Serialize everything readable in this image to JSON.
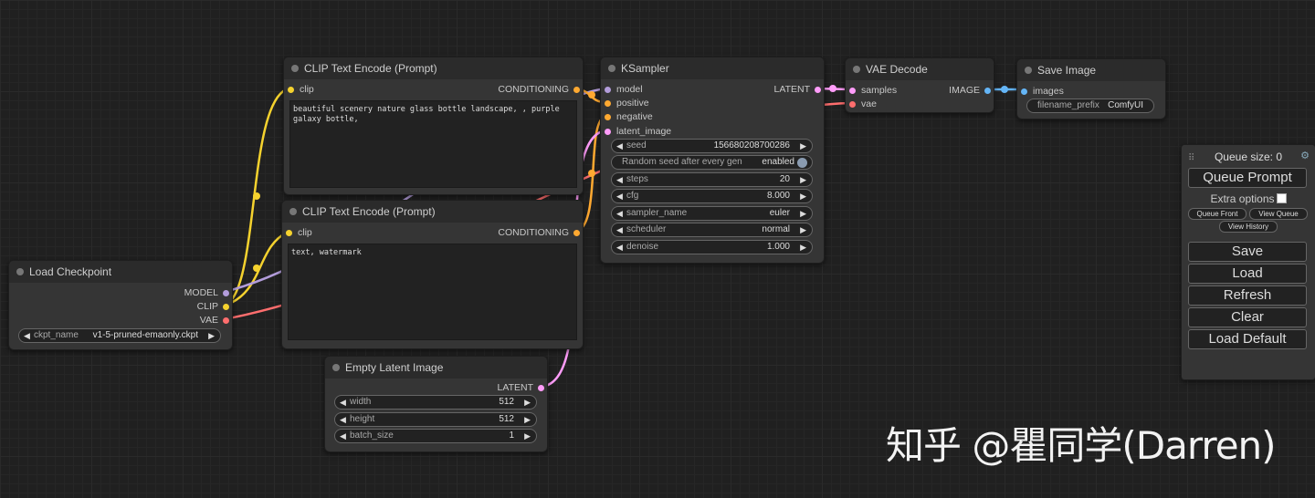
{
  "nodes": {
    "clip_pos": {
      "title": "CLIP Text Encode (Prompt)",
      "input": "clip",
      "output": "CONDITIONING",
      "text": "beautiful scenery nature glass bottle landscape, , purple galaxy bottle,"
    },
    "clip_neg": {
      "title": "CLIP Text Encode (Prompt)",
      "input": "clip",
      "output": "CONDITIONING",
      "text": "text, watermark"
    },
    "load_checkpoint": {
      "title": "Load Checkpoint",
      "outputs": [
        "MODEL",
        "CLIP",
        "VAE"
      ],
      "widget": {
        "label": "ckpt_name",
        "value": "v1-5-pruned-emaonly.ckpt"
      }
    },
    "ksampler": {
      "title": "KSampler",
      "inputs": [
        "model",
        "positive",
        "negative",
        "latent_image"
      ],
      "output": "LATENT",
      "widgets": [
        {
          "label": "seed",
          "value": "156680208700286"
        },
        {
          "label": "Random seed after every gen",
          "value": "enabled"
        },
        {
          "label": "steps",
          "value": "20"
        },
        {
          "label": "cfg",
          "value": "8.000"
        },
        {
          "label": "sampler_name",
          "value": "euler"
        },
        {
          "label": "scheduler",
          "value": "normal"
        },
        {
          "label": "denoise",
          "value": "1.000"
        }
      ]
    },
    "vae_decode": {
      "title": "VAE Decode",
      "inputs": [
        "samples",
        "vae"
      ],
      "output": "IMAGE"
    },
    "save_image": {
      "title": "Save Image",
      "input": "images",
      "widget": {
        "label": "filename_prefix",
        "value": "ComfyUI"
      }
    },
    "empty_latent": {
      "title": "Empty Latent Image",
      "output": "LATENT",
      "widgets": [
        {
          "label": "width",
          "value": "512"
        },
        {
          "label": "height",
          "value": "512"
        },
        {
          "label": "batch_size",
          "value": "1"
        }
      ]
    }
  },
  "menu": {
    "queue_size": "Queue size: 0",
    "queue_prompt": "Queue Prompt",
    "extra_options": "Extra options",
    "queue_front": "Queue Front",
    "view_queue": "View Queue",
    "view_history": "View History",
    "save": "Save",
    "load": "Load",
    "refresh": "Refresh",
    "clear": "Clear",
    "load_default": "Load Default"
  },
  "watermark": "知乎 @瞿同学(Darren)",
  "colors": {
    "clip": "#f5d22e",
    "model": "#b39ddb",
    "vae": "#ff6e6e",
    "conditioning": "#ffa931",
    "latent": "#ff9cf9",
    "image": "#64b5f6",
    "background": "#202020",
    "node": "#353535"
  }
}
